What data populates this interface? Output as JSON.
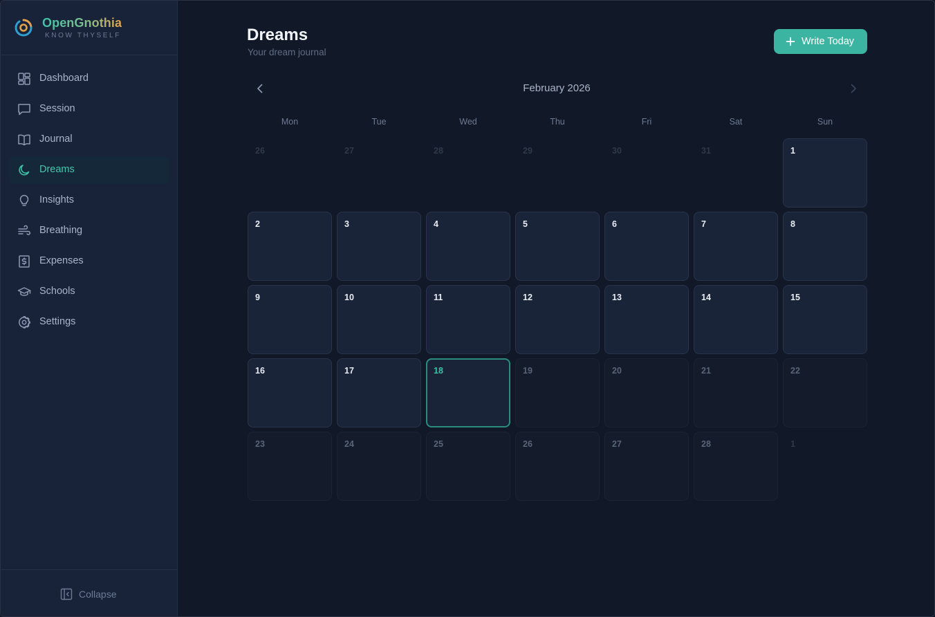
{
  "brand": {
    "name": "OpenGnothia",
    "tagline": "KNOW THYSELF"
  },
  "sidebar": {
    "items": [
      {
        "label": "Dashboard",
        "icon": "dashboard-icon"
      },
      {
        "label": "Session",
        "icon": "message-square-icon"
      },
      {
        "label": "Journal",
        "icon": "book-open-icon"
      },
      {
        "label": "Dreams",
        "icon": "moon-icon",
        "active": true
      },
      {
        "label": "Insights",
        "icon": "lightbulb-icon"
      },
      {
        "label": "Breathing",
        "icon": "wind-icon"
      },
      {
        "label": "Expenses",
        "icon": "receipt-dollar-icon"
      },
      {
        "label": "Schools",
        "icon": "graduation-cap-icon"
      },
      {
        "label": "Settings",
        "icon": "gear-icon"
      }
    ],
    "collapse_label": "Collapse"
  },
  "header": {
    "title": "Dreams",
    "subtitle": "Your dream journal",
    "write_button_label": "Write Today"
  },
  "calendar": {
    "month_label": "February 2026",
    "weekdays": [
      "Mon",
      "Tue",
      "Wed",
      "Thu",
      "Fri",
      "Sat",
      "Sun"
    ],
    "days": [
      {
        "n": "26",
        "state": "outside"
      },
      {
        "n": "27",
        "state": "outside"
      },
      {
        "n": "28",
        "state": "outside"
      },
      {
        "n": "29",
        "state": "outside"
      },
      {
        "n": "30",
        "state": "outside"
      },
      {
        "n": "31",
        "state": "outside"
      },
      {
        "n": "1",
        "state": "past"
      },
      {
        "n": "2",
        "state": "past"
      },
      {
        "n": "3",
        "state": "past"
      },
      {
        "n": "4",
        "state": "past"
      },
      {
        "n": "5",
        "state": "past"
      },
      {
        "n": "6",
        "state": "past"
      },
      {
        "n": "7",
        "state": "past"
      },
      {
        "n": "8",
        "state": "past"
      },
      {
        "n": "9",
        "state": "past"
      },
      {
        "n": "10",
        "state": "past"
      },
      {
        "n": "11",
        "state": "past"
      },
      {
        "n": "12",
        "state": "past"
      },
      {
        "n": "13",
        "state": "past"
      },
      {
        "n": "14",
        "state": "past"
      },
      {
        "n": "15",
        "state": "past"
      },
      {
        "n": "16",
        "state": "past"
      },
      {
        "n": "17",
        "state": "past"
      },
      {
        "n": "18",
        "state": "today"
      },
      {
        "n": "19",
        "state": "future"
      },
      {
        "n": "20",
        "state": "future"
      },
      {
        "n": "21",
        "state": "future"
      },
      {
        "n": "22",
        "state": "future"
      },
      {
        "n": "23",
        "state": "future"
      },
      {
        "n": "24",
        "state": "future"
      },
      {
        "n": "25",
        "state": "future"
      },
      {
        "n": "26",
        "state": "future"
      },
      {
        "n": "27",
        "state": "future"
      },
      {
        "n": "28",
        "state": "future"
      },
      {
        "n": "1",
        "state": "outside"
      }
    ]
  },
  "colors": {
    "accent": "#3bb5a1",
    "background": "#111827",
    "sidebar": "#18233a"
  }
}
